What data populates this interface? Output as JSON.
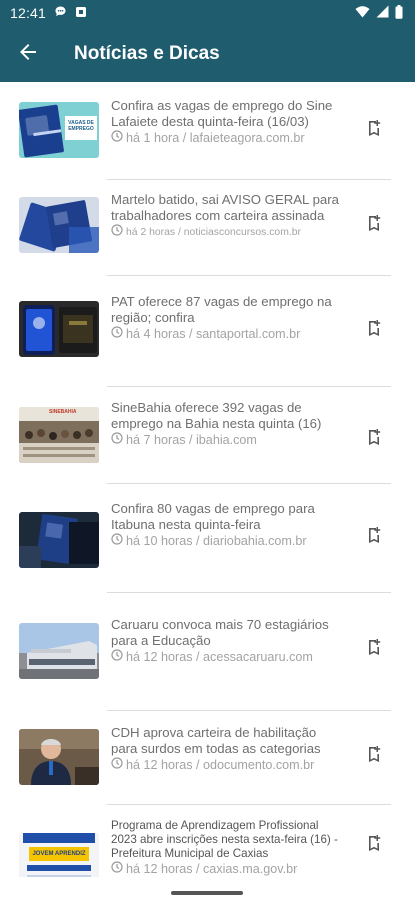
{
  "status_bar": {
    "time": "12:41",
    "icons": [
      "chat-bubble-icon",
      "square-notification-icon",
      "wifi-icon",
      "signal-icon",
      "battery-icon"
    ]
  },
  "app_bar": {
    "title": "Notícias e Dicas",
    "back_icon": "arrow-back-icon",
    "color": "#1f5c6e"
  },
  "news": [
    {
      "title": "Confira as vagas de emprego do Sine Lafaiete desta quinta-feira (16/03)",
      "meta": "há 1 hora / lafaieteagora.com.br",
      "thumb_text": "VAGAS DE EMPREGO"
    },
    {
      "title": "Martelo batido, sai AVISO GERAL para trabalhadores com carteira assinada",
      "meta": "há 2 horas / noticiasconcursos.com.br"
    },
    {
      "title": "PAT oferece 87 vagas de emprego na região; confira",
      "meta": "há 4 horas / santaportal.com.br"
    },
    {
      "title": "SineBahia oferece 392 vagas de emprego na Bahia nesta quinta (16)",
      "meta": "há 7 horas / ibahia.com",
      "thumb_text": "SINEBAHIA"
    },
    {
      "title": "Confira 80 vagas de emprego para Itabuna nesta quinta-feira",
      "meta": "há 10 horas / diariobahia.com.br"
    },
    {
      "title": "Caruaru convoca mais 70 estagiários para a Educação",
      "meta": "há 12 horas / acessacaruaru.com"
    },
    {
      "title": "CDH aprova carteira de habilitação para surdos em todas as categorias",
      "meta": "há 12 horas / odocumento.com.br"
    },
    {
      "title": "Programa de Aprendizagem Profissional 2023 abre inscrições nesta sexta-feira (16) - Prefeitura Municipal de Caxias",
      "meta": "há 12 horas / caxias.ma.gov.br",
      "thumb_text": "JOVEM APRENDIZ"
    }
  ],
  "icons": {
    "clock": "clock-icon",
    "bookmark": "bookmark-add-icon"
  }
}
